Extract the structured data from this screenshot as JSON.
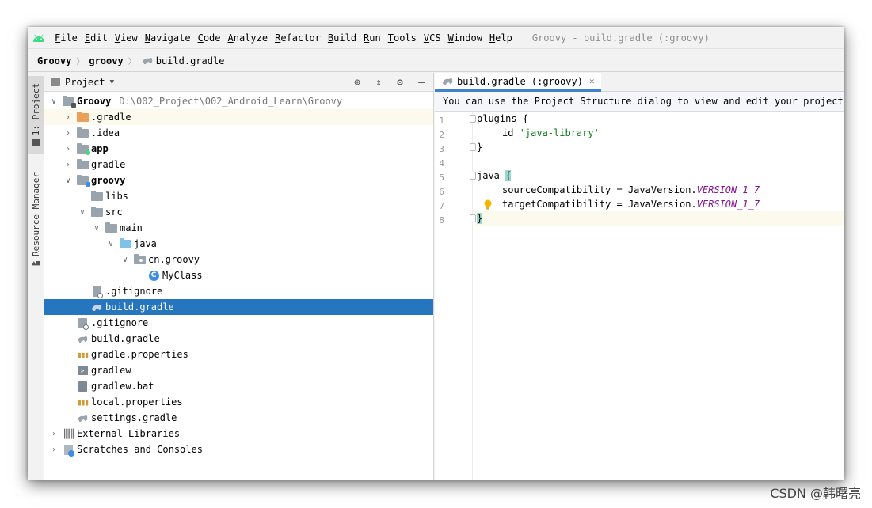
{
  "window": {
    "title": "Groovy - build.gradle (:groovy)",
    "menu": [
      "File",
      "Edit",
      "View",
      "Navigate",
      "Code",
      "Analyze",
      "Refactor",
      "Build",
      "Run",
      "Tools",
      "VCS",
      "Window",
      "Help"
    ]
  },
  "breadcrumb": {
    "items": [
      "Groovy",
      "groovy"
    ],
    "file": "build.gradle"
  },
  "toolwindows": {
    "project": "1: Project",
    "resource_manager": "Resource Manager"
  },
  "project_panel": {
    "title": "Project",
    "root": {
      "name": "Groovy",
      "path": "D:\\002_Project\\002_Android_Learn\\Groovy"
    },
    "items": [
      {
        "label": ".gradle"
      },
      {
        "label": ".idea"
      },
      {
        "label": "app"
      },
      {
        "label": "gradle"
      },
      {
        "label": "groovy"
      },
      {
        "label": "libs"
      },
      {
        "label": "src"
      },
      {
        "label": "main"
      },
      {
        "label": "java"
      },
      {
        "label": "cn.groovy"
      },
      {
        "label": "MyClass"
      },
      {
        "label": ".gitignore"
      },
      {
        "label": "build.gradle"
      },
      {
        "label": ".gitignore"
      },
      {
        "label": "build.gradle"
      },
      {
        "label": "gradle.properties"
      },
      {
        "label": "gradlew"
      },
      {
        "label": "gradlew.bat"
      },
      {
        "label": "local.properties"
      },
      {
        "label": "settings.gradle"
      },
      {
        "label": "External Libraries"
      },
      {
        "label": "Scratches and Consoles"
      }
    ]
  },
  "editor": {
    "tab_label": "build.gradle (:groovy)",
    "banner": "You can use the Project Structure dialog to view and edit your project co",
    "line_numbers": [
      "1",
      "2",
      "3",
      "4",
      "5",
      "6",
      "7",
      "8"
    ],
    "code": {
      "l1": "plugins {",
      "l2_kw": "id ",
      "l2_str": "'java-library'",
      "l3": "}",
      "l5_kw": "java ",
      "l5_brace": "{",
      "l6_a": "sourceCompatibility = JavaVersion.",
      "l6_b": "VERSION_1_7",
      "l7_a": "targetCompatibility = JavaVersion.",
      "l7_b": "VERSION_1_7",
      "l8": "}"
    }
  },
  "watermark": "CSDN @韩曙亮",
  "colors": {
    "selection": "#2675bf",
    "accent": "#4083c9",
    "string": "#067d17",
    "constant": "#871094"
  }
}
